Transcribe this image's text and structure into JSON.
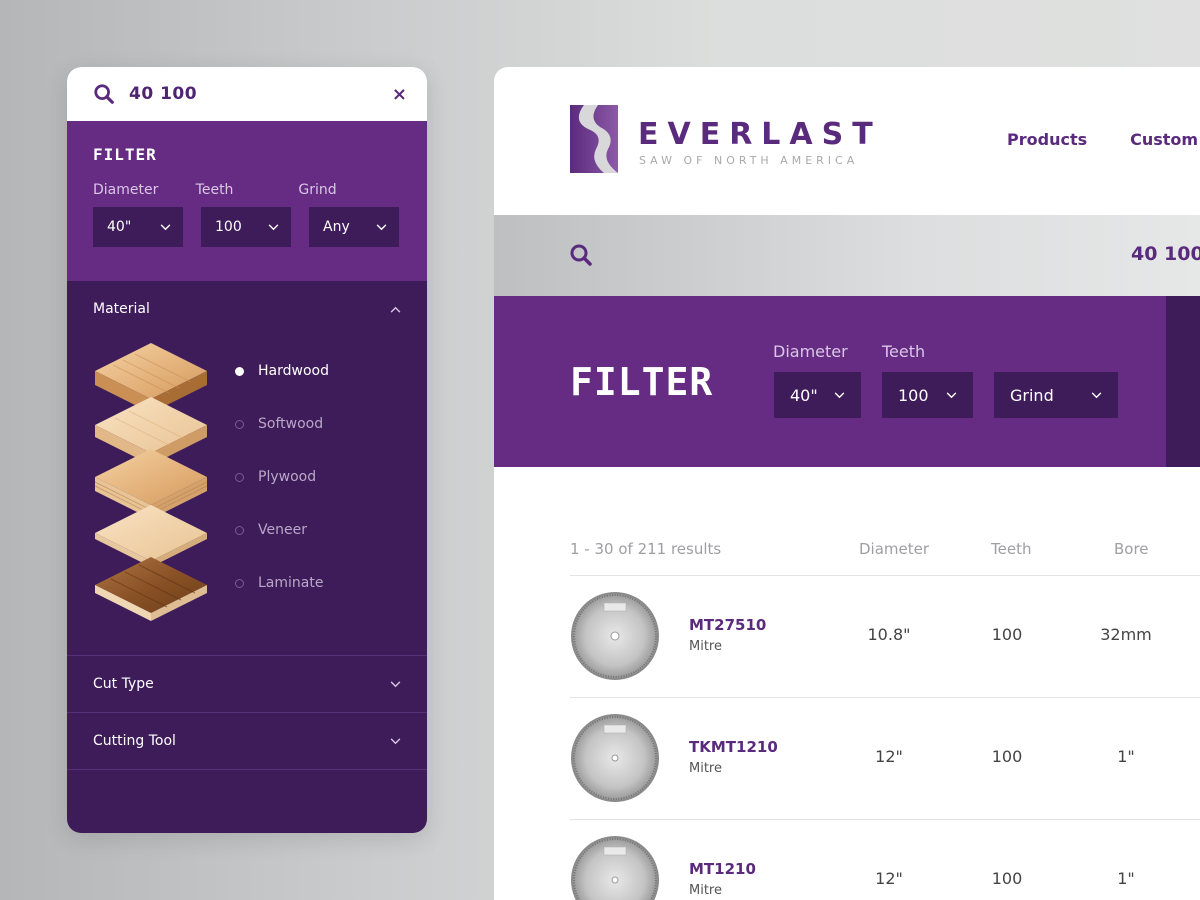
{
  "colors": {
    "brand_purple": "#662c83",
    "deep_purple": "#3e1c5a",
    "white": "#ffffff"
  },
  "mobile": {
    "search": {
      "icon": "search-icon",
      "query": "40 100",
      "clear_icon": "close-icon",
      "clear": "×"
    },
    "filter": {
      "title": "FILTER",
      "labels": {
        "diameter": "Diameter",
        "teeth": "Teeth",
        "grind": "Grind"
      },
      "values": {
        "diameter": "40\"",
        "teeth": "100",
        "grind": "Any"
      }
    },
    "sections": {
      "material": {
        "label": "Material",
        "options": [
          "Hardwood",
          "Softwood",
          "Plywood",
          "Veneer",
          "Laminate"
        ],
        "selected": "Hardwood"
      },
      "cut_type": {
        "label": "Cut Type"
      },
      "cutting_tool": {
        "label": "Cutting Tool"
      }
    }
  },
  "desktop": {
    "brand": {
      "name": "EVERLAST",
      "tagline": "SAW OF NORTH AMERICA"
    },
    "nav": [
      "Products",
      "Custom"
    ],
    "search": {
      "icon": "search-icon",
      "query": "40 100"
    },
    "filter": {
      "title": "FILTER",
      "labels": {
        "diameter": "Diameter",
        "teeth": "Teeth"
      },
      "values": {
        "diameter": "40\"",
        "teeth": "100",
        "grind": "Grind"
      }
    },
    "results": {
      "summary": "1 - 30 of 211 results",
      "columns": [
        "Diameter",
        "Teeth",
        "Bore"
      ],
      "rows": [
        {
          "sku": "MT27510",
          "type": "Mitre",
          "diameter": "10.8\"",
          "teeth": "100",
          "bore": "32mm"
        },
        {
          "sku": "TKMT1210",
          "type": "Mitre",
          "diameter": "12\"",
          "teeth": "100",
          "bore": "1\""
        },
        {
          "sku": "MT1210",
          "type": "Mitre",
          "diameter": "12\"",
          "teeth": "100",
          "bore": "1\""
        }
      ]
    }
  }
}
